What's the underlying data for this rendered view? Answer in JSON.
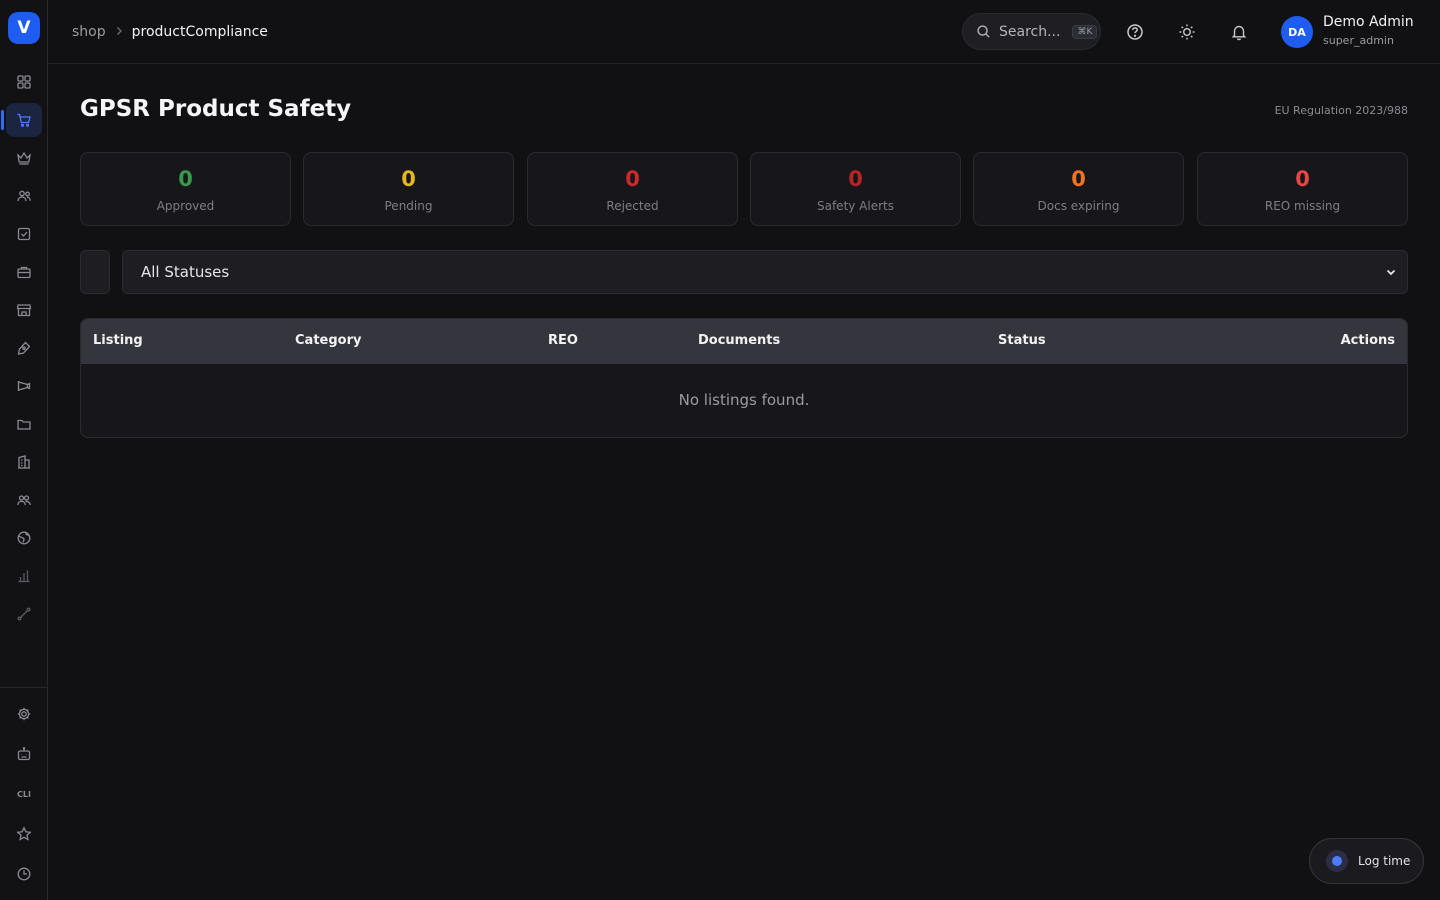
{
  "app": {
    "logo_letter": "V",
    "brand_color": "#1f5cf2"
  },
  "sidebar": {
    "top_items": [
      {
        "icon": "grid-icon",
        "active": false
      },
      {
        "icon": "shopping-cart-icon",
        "active": true
      },
      {
        "icon": "crown-icon",
        "active": false
      },
      {
        "icon": "users-icon",
        "active": false
      },
      {
        "icon": "checkbox-icon",
        "active": false
      },
      {
        "icon": "briefcase-icon",
        "active": false
      },
      {
        "icon": "store-icon",
        "active": false
      },
      {
        "icon": "pen-tool-icon",
        "active": false
      },
      {
        "icon": "megaphone-icon",
        "active": false
      },
      {
        "icon": "folder-icon",
        "active": false
      },
      {
        "icon": "building-icon",
        "active": false
      },
      {
        "icon": "team-icon",
        "active": false
      },
      {
        "icon": "globe-icon",
        "active": false
      },
      {
        "icon": "bar-chart-icon",
        "active": false
      },
      {
        "icon": "route-icon",
        "active": false
      }
    ],
    "bottom_items": [
      {
        "icon": "settings-icon"
      },
      {
        "icon": "robot-icon"
      },
      {
        "icon": "cli-icon",
        "label": "CLI"
      },
      {
        "icon": "star-icon"
      },
      {
        "icon": "clock-icon"
      }
    ]
  },
  "header": {
    "breadcrumb": [
      "shop",
      "productCompliance"
    ],
    "search_placeholder": "Search...",
    "search_shortcut": "⌘K",
    "user": {
      "initials": "DA",
      "name": "Demo Admin",
      "role": "super_admin"
    }
  },
  "main": {
    "title": "GPSR Product Safety",
    "regulation": "EU Regulation 2023/988",
    "stats": [
      {
        "value": "0",
        "label": "Approved",
        "color": "#3a9a4a"
      },
      {
        "value": "0",
        "label": "Pending",
        "color": "#e3b81a"
      },
      {
        "value": "0",
        "label": "Rejected",
        "color": "#cc2a2a"
      },
      {
        "value": "0",
        "label": "Safety Alerts",
        "color": "#b82323"
      },
      {
        "value": "0",
        "label": "Docs expiring",
        "color": "#f0731e"
      },
      {
        "value": "0",
        "label": "REO missing",
        "color": "#e84545"
      }
    ],
    "status_filter": {
      "selected": "All Statuses"
    },
    "table": {
      "columns": [
        "Listing",
        "Category",
        "REO",
        "Documents",
        "Status",
        "Actions"
      ],
      "rows": [],
      "empty_message": "No listings found."
    }
  },
  "log_time": {
    "label": "Log time"
  }
}
